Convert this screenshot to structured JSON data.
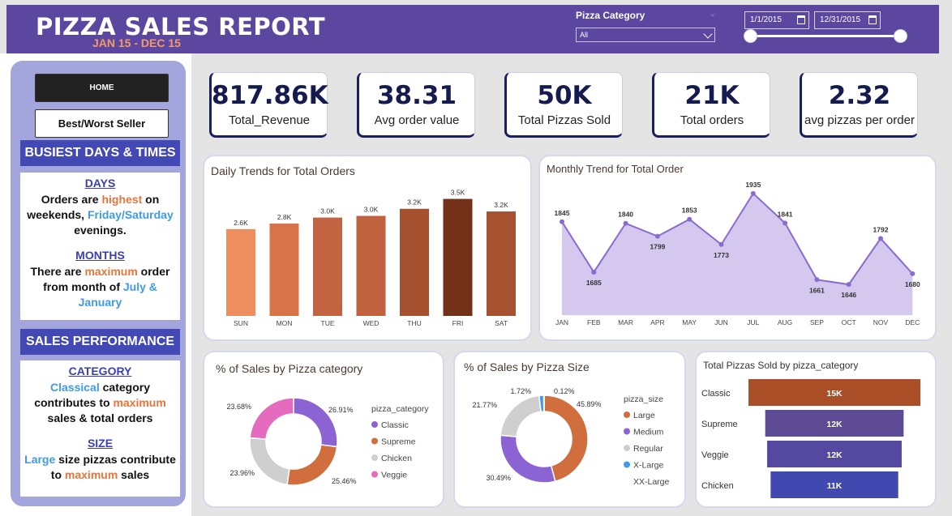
{
  "header": {
    "title": "PIZZA SALES REPORT",
    "subtitle": "JAN 15 - DEC 15",
    "filter_label": "Pizza Category",
    "dropdown_value": "All",
    "date_start": "1/1/2015",
    "date_end": "12/31/2015",
    "date_range_slider": [
      0,
      1
    ]
  },
  "sidebar": {
    "home_label": "HOME",
    "bestworst_label": "Best/Worst Seller",
    "busiest_title": "BUSIEST DAYS & TIMES",
    "days_head": "DAYS",
    "days_t1": "Orders are ",
    "days_t2": "highest",
    "days_t3": " on weekends, ",
    "days_t4": "Friday/Saturday",
    "days_t5": " evenings.",
    "months_head": "MONTHS",
    "months_t1": "There are ",
    "months_t2": "maximum",
    "months_t3": " order from month of ",
    "months_t4": "July & January",
    "perf_title": "SALES PERFORMANCE",
    "cat_head": "CATEGORY",
    "cat_t1": "Classical",
    "cat_t2": " category contributes to ",
    "cat_t3": "maximum",
    "cat_t4": " sales & total orders",
    "size_head": "SIZE",
    "size_t1": "Large",
    "size_t2": " size pizzas contribute to ",
    "size_t3": "maximum",
    "size_t4": " sales"
  },
  "kpis": [
    {
      "value": "817.86K",
      "label": "Total_Revenue"
    },
    {
      "value": "38.31",
      "label": "Avg order value"
    },
    {
      "value": "50K",
      "label": "Total Pizzas Sold"
    },
    {
      "value": "21K",
      "label": "Total orders"
    },
    {
      "value": "2.32",
      "label": "avg pizzas per order"
    }
  ],
  "chart_data": [
    {
      "type": "bar",
      "title": "Daily Trends for Total Orders",
      "categories": [
        "SUN",
        "MON",
        "TUE",
        "WED",
        "THU",
        "FRI",
        "SAT"
      ],
      "values": [
        2624,
        2794,
        2973,
        3024,
        3239,
        3538,
        3158
      ],
      "labels": [
        "2.6K",
        "2.8K",
        "3.0K",
        "3.0K",
        "3.2K",
        "3.5K",
        "3.2K"
      ],
      "colors": [
        "#ee8d5e",
        "#d9734a",
        "#c26441",
        "#c0623f",
        "#a5502f",
        "#73311a",
        "#a65231"
      ],
      "ylim": [
        0,
        3600
      ]
    },
    {
      "type": "area",
      "title": "Monthly Trend for Total Order",
      "categories": [
        "JAN",
        "FEB",
        "MAR",
        "APR",
        "MAY",
        "JUN",
        "JUL",
        "AUG",
        "SEP",
        "OCT",
        "NOV",
        "DEC"
      ],
      "values": [
        1845,
        1685,
        1840,
        1799,
        1853,
        1773,
        1935,
        1841,
        1661,
        1646,
        1792,
        1680
      ],
      "ylim": [
        1600,
        1950
      ],
      "line_color": "#8a6cd0",
      "fill_color": "#d4c8ee"
    },
    {
      "type": "pie",
      "title": "% of Sales by Pizza category",
      "legend_title": "pizza_category",
      "categories": [
        "Classic",
        "Supreme",
        "Chicken",
        "Veggie"
      ],
      "values": [
        26.91,
        25.46,
        23.96,
        23.68
      ],
      "labels": [
        "26.91%",
        "25.46%",
        "23.96%",
        "23.68%"
      ],
      "colors": [
        "#8b63d3",
        "#d06e3d",
        "#cfcfcf",
        "#e56bbf"
      ]
    },
    {
      "type": "pie",
      "title": "% of Sales by Pizza Size",
      "legend_title": "pizza_size",
      "categories": [
        "Large",
        "Medium",
        "Regular",
        "X-Large",
        "XX-Large"
      ],
      "values": [
        45.89,
        30.49,
        21.77,
        1.72,
        0.12
      ],
      "labels": [
        "45.89%",
        "30.49%",
        "21.77%",
        "1.72%",
        "0.12%"
      ],
      "colors": [
        "#d06e3d",
        "#8b63d3",
        "#cfcfcf",
        "#3d9be9",
        "#8a6fa8"
      ]
    },
    {
      "type": "bar",
      "title": "Total Pizzas Sold by pizza_category",
      "orientation": "horizontal-funnel",
      "categories": [
        "Classic",
        "Supreme",
        "Veggie",
        "Chicken"
      ],
      "values": [
        14888,
        11987,
        11649,
        11050
      ],
      "labels": [
        "15K",
        "12K",
        "12K",
        "11K"
      ],
      "colors": [
        "#a94e27",
        "#5c4a94",
        "#5548a0",
        "#4148b0"
      ]
    }
  ]
}
